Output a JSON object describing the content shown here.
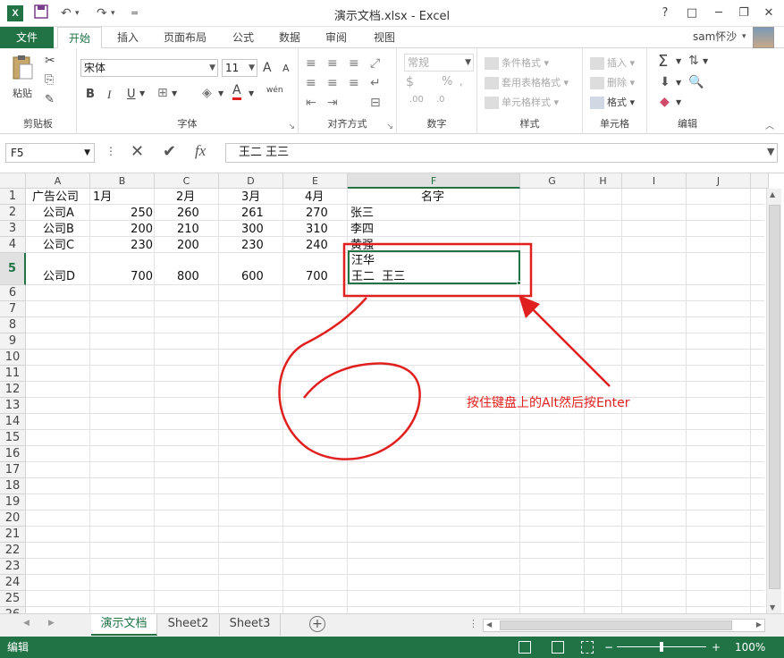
{
  "window": {
    "title": "演示文档.xlsx - Excel",
    "app_icon": "X",
    "help": "?",
    "buttons": [
      "?",
      "□",
      "─",
      "❐",
      "✕"
    ]
  },
  "qat": {
    "save_icon": "save-icon",
    "undo": "↶",
    "redo": "↷",
    "customize": "="
  },
  "ribbon_tabs": {
    "file": "文件",
    "items": [
      "开始",
      "插入",
      "页面布局",
      "公式",
      "数据",
      "审阅",
      "视图"
    ],
    "active": "开始",
    "user": "sam怀沙"
  },
  "ribbon": {
    "clipboard": {
      "label": "剪贴板",
      "paste": "粘贴"
    },
    "font": {
      "label": "字体",
      "name": "宋体",
      "size": "11",
      "bold": "B",
      "italic": "I",
      "underline": "U",
      "grow": "A",
      "shrink": "A",
      "color_a": "A",
      "wen": "wén"
    },
    "alignment": {
      "label": "对齐方式"
    },
    "number": {
      "label": "数字",
      "format": "常规"
    },
    "styles": {
      "label": "样式",
      "cond": "条件格式",
      "table": "套用表格格式",
      "cell": "单元格样式"
    },
    "cells": {
      "label": "单元格",
      "insert": "插入",
      "delete": "删除",
      "format": "格式"
    },
    "editing": {
      "label": "编辑",
      "sum": "Σ"
    }
  },
  "formula_bar": {
    "name_box": "F5",
    "content": "王二  王三",
    "fx": "fx"
  },
  "columns": [
    "A",
    "B",
    "C",
    "D",
    "E",
    "F",
    "G",
    "H",
    "I",
    "J"
  ],
  "selected_column": "F",
  "rows": [
    "1",
    "2",
    "3",
    "4",
    "5",
    "6",
    "7",
    "8",
    "9",
    "10",
    "11",
    "12",
    "13",
    "14",
    "15",
    "16",
    "17",
    "18",
    "19",
    "20",
    "21",
    "22",
    "23",
    "24",
    "25",
    "26"
  ],
  "selected_row": "5",
  "cells": {
    "A1": "广告公司",
    "B1": "1月",
    "C1": "2月",
    "D1": "3月",
    "E1": "4月",
    "F1": "名字",
    "A2": "公司A",
    "B2": "250",
    "C2": "260",
    "D2": "261",
    "E2": "270",
    "F2": "张三",
    "A3": "公司B",
    "B3": "200",
    "C3": "210",
    "D3": "300",
    "E3": "310",
    "F3": "李四",
    "A4": "公司C",
    "B4": "230",
    "C4": "200",
    "D4": "230",
    "E4": "240",
    "F4": "黄强",
    "A5": "公司D",
    "B5": "700",
    "C5": "800",
    "D5": "600",
    "E5": "700",
    "F5_line1": "汪华",
    "F5_line2": "王二  王三"
  },
  "annotation": "按住键盘上的Alt然后按Enter",
  "sheets": {
    "tabs": [
      "演示文档",
      "Sheet2",
      "Sheet3"
    ],
    "active": "演示文档",
    "add": "+"
  },
  "status": {
    "mode": "编辑",
    "zoom": "100%"
  },
  "colors": {
    "excel_green": "#217346",
    "annotation_red": "#e0201e"
  }
}
